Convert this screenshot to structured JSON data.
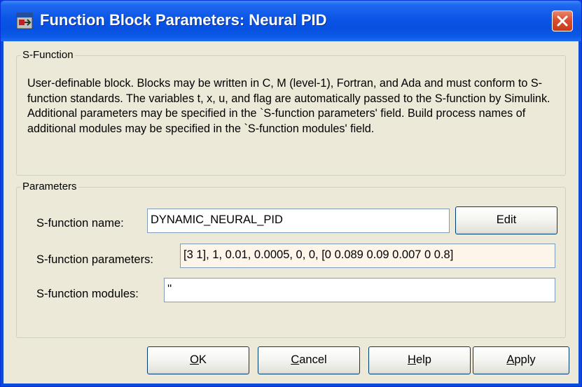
{
  "window": {
    "title": "Function Block Parameters: Neural PID"
  },
  "sfunction_group": {
    "legend": "S-Function",
    "description": "User-definable block.  Blocks may be written in C, M (level-1), Fortran, and Ada and must conform to S-function standards.  The variables t, x, u, and flag are automatically passed to the S-function by Simulink.  Additional parameters may be specified in the `S-function parameters' field. Build process names of additional modules may be specified in the `S-function modules' field."
  },
  "parameters_group": {
    "legend": "Parameters",
    "name_label": "S-function name:",
    "name_value": "DYNAMIC_NEURAL_PID",
    "edit_button": "Edit",
    "params_label": "S-function parameters:",
    "params_value": "[3 1], 1, 0.01, 0.0005, 0, 0, [0 0.089 0.09 0.007 0 0.8]",
    "modules_label": "S-function modules:",
    "modules_value": "''"
  },
  "buttons": {
    "ok_prefix": "",
    "ok_mnemonic": "O",
    "ok_rest": "K",
    "cancel_mnemonic": "C",
    "cancel_rest": "ancel",
    "help_mnemonic": "H",
    "help_rest": "elp",
    "apply_mnemonic": "A",
    "apply_rest": "pply"
  },
  "icons": {
    "app": "simulink-block-icon",
    "close": "close-icon"
  },
  "colors": {
    "titlebar": "#0a55e6",
    "close_button": "#d9502e",
    "dialog_background": "#ece9d8",
    "field_border": "#7f9db9",
    "focused_field_background": "#fdf4ea"
  }
}
